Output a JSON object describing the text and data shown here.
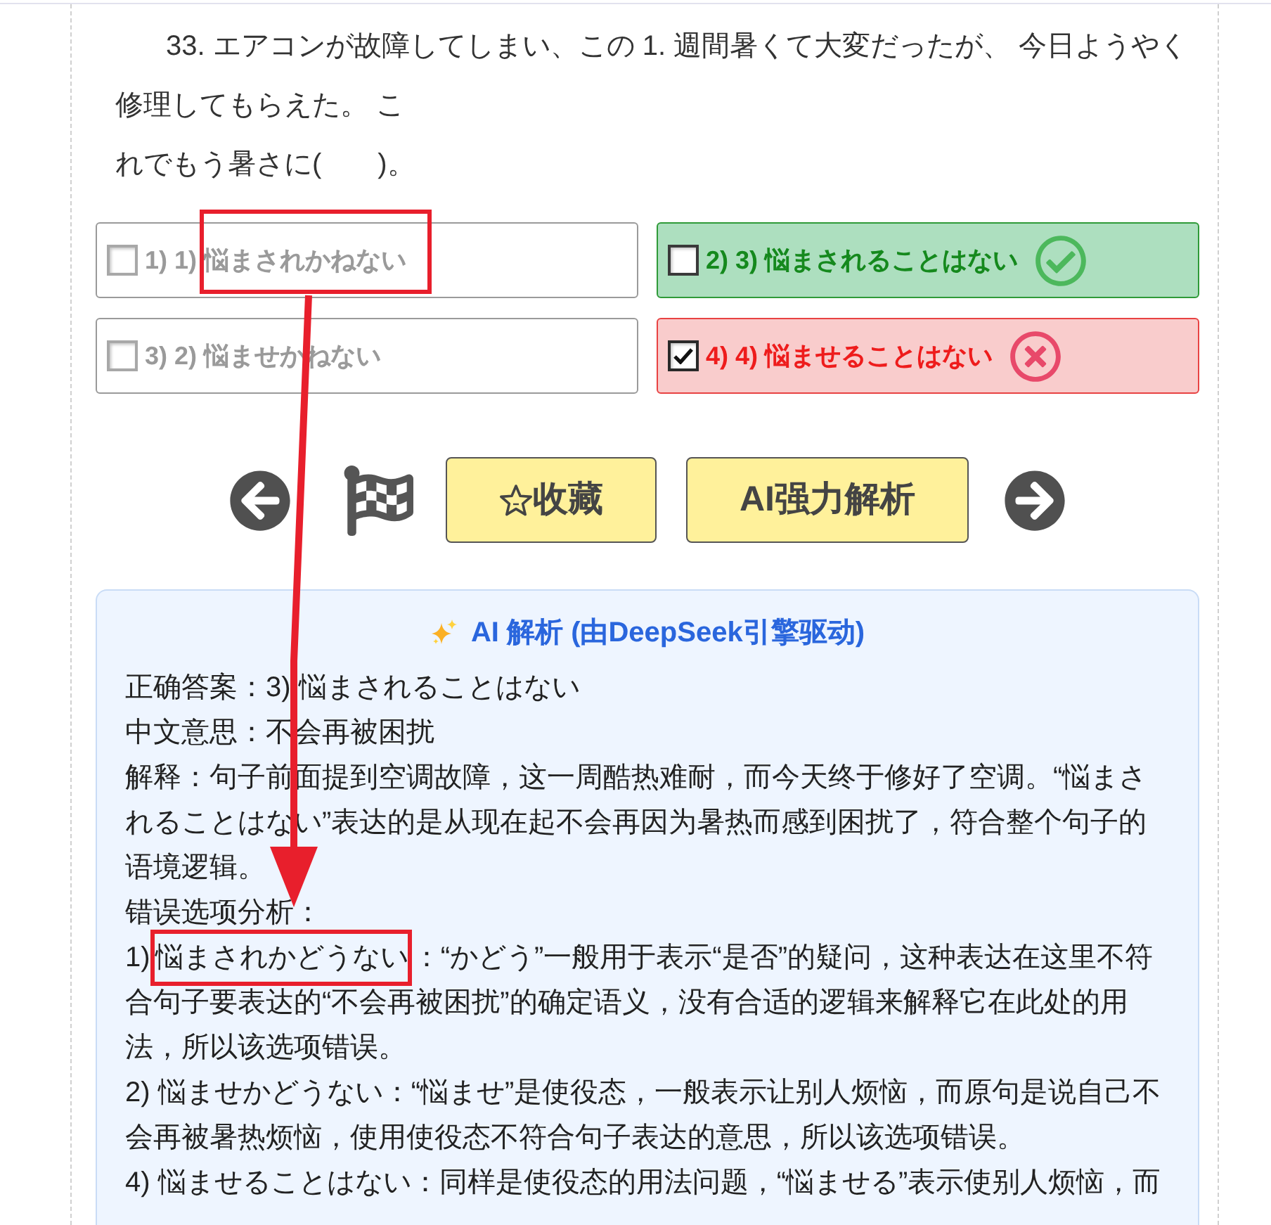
{
  "question": {
    "lines": [
      "33. エアコンが故障してしまい、この 1. 週間暑くて大変だったが、 今日ようやく修理してもらえた。 こ",
      "れでもう暑さに(　　)。"
    ]
  },
  "options": [
    {
      "label": "1) 1) 悩まされかねない",
      "checked": false,
      "kind": "neutral"
    },
    {
      "label": "2) 3) 悩まされることはない",
      "checked": false,
      "kind": "correct"
    },
    {
      "label": "3) 2) 悩ませかねない",
      "checked": false,
      "kind": "neutral"
    },
    {
      "label": "4) 4) 悩ませることはない",
      "checked": true,
      "kind": "wrong"
    }
  ],
  "toolbar": {
    "actions": [
      {
        "kind": "favorite",
        "label": "收藏"
      },
      {
        "kind": "ai",
        "label": "AI强力解析"
      }
    ]
  },
  "analysis": {
    "title": "AI 解析 (由DeepSeek引擎驱动)",
    "paragraphs": [
      {
        "parts": [
          {
            "text": "正确答案：3) 悩まされることはない",
            "highlighted": false
          }
        ]
      },
      {
        "parts": [
          {
            "text": "中文意思：不会再被困扰",
            "highlighted": false
          }
        ]
      },
      {
        "parts": [
          {
            "text": "解释：句子前面提到空调故障，这一周酷热难耐，而今天终于修好了空调。“悩まされることはない”表达的是从现在起不会再因为暑热而感到困扰了，符合整个句子的语境逻辑。",
            "highlighted": false
          }
        ]
      },
      {
        "parts": [
          {
            "text": "错误选项分析：",
            "highlighted": false
          }
        ]
      },
      {
        "parts": [
          {
            "text": "1) ",
            "highlighted": false
          },
          {
            "text": "悩まされかどうない",
            "highlighted": true
          },
          {
            "text": "：“かどう”一般用于表示“是否”的疑问，这种表达在这里不符合句子要表达的“不会再被困扰”的确定语义，没有合适的逻辑来解释它在此处的用法，所以该选项错误。",
            "highlighted": false
          }
        ]
      },
      {
        "parts": [
          {
            "text": "2) 悩ませかどうない：“悩ませ”是使役态，一般表示让别人烦恼，而原句是说自己不会再被暑热烦恼，使用使役态不符合句子表达的意思，所以该选项错误。",
            "highlighted": false
          }
        ]
      },
      {
        "parts": [
          {
            "text": "4) 悩ませることはない：同样是使役态的用法问题，“悩ませる”表示使别人烦恼，而",
            "highlighted": false
          }
        ]
      }
    ]
  }
}
